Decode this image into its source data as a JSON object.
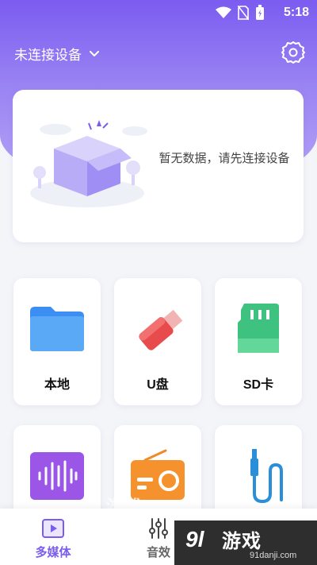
{
  "status_bar": {
    "time": "5:18"
  },
  "header": {
    "device_label": "未连接设备"
  },
  "empty_state": {
    "message": "暂无数据，请先连接设备"
  },
  "tiles": [
    {
      "label": "本地",
      "icon": "folder-icon"
    },
    {
      "label": "U盘",
      "icon": "usb-drive-icon"
    },
    {
      "label": "SD卡",
      "icon": "sd-card-icon"
    },
    {
      "label": "",
      "icon": "audio-wave-icon"
    },
    {
      "label": "",
      "icon": "radio-icon"
    },
    {
      "label": "",
      "icon": "aux-cable-icon"
    }
  ],
  "bottom_nav": [
    {
      "label": "多媒体",
      "icon": "play-square-icon",
      "active": true
    },
    {
      "label": "音效",
      "icon": "equalizer-icon",
      "active": false
    }
  ],
  "watermark": {
    "logo": "9l",
    "title": "游戏",
    "url": "91danji.com"
  },
  "colors": {
    "accent": "#7a5cf0",
    "header_top": "#7b5cf0",
    "background": "#f4f5f9"
  }
}
